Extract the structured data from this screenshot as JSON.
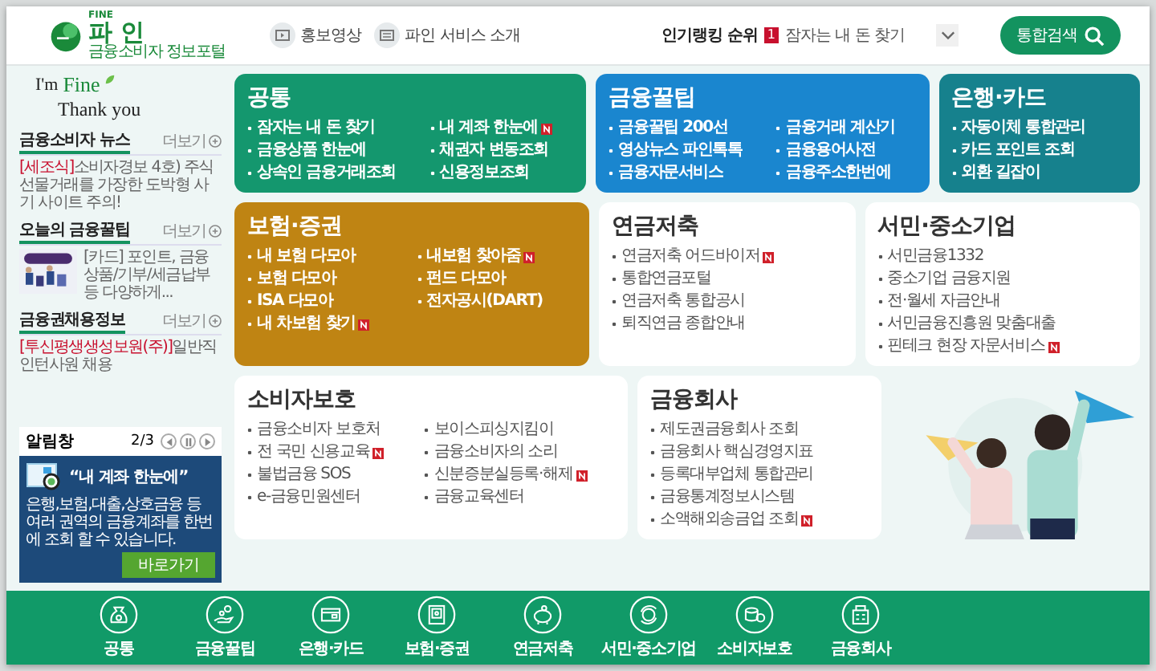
{
  "header": {
    "logo": {
      "mark": "FINE",
      "name": "파 인",
      "subtitle": "금융소비자 정보포털"
    },
    "nav": [
      {
        "label": "홍보영상"
      },
      {
        "label": "파인 서비스 소개"
      }
    ],
    "ranking": {
      "label": "인기랭킹 순위",
      "rank": "1",
      "item": "잠자는 내 돈 찾기"
    },
    "search_button": "통합검색"
  },
  "greeting": {
    "prefix": "I'm",
    "word": "Fine",
    "line2": "Thank you"
  },
  "sidebar": [
    {
      "title": "금융소비자 뉴스",
      "more": "더보기",
      "tag": "[세조식]",
      "text": "소비자경보 4호) 주식선물거래를 가장한 도박형 사기 사이트 주의!"
    },
    {
      "title": "오늘의 금융꿀팁",
      "more": "더보기",
      "image": {
        "kind": "picture"
      },
      "text": "[카드] 포인트, 금융상품/기부/세금납부 등 다양하게..."
    },
    {
      "title": "금융권채용정보",
      "more": "더보기",
      "tag": "[투신평생생성보원(주)]",
      "text": "일반직 인턴사원 채용"
    }
  ],
  "notice": {
    "title": "알림창",
    "page": "2/3",
    "banner_title": "“내 계좌 한눈에”",
    "banner_text": "은행,보험,대출,상호금융 등 여러 권역의 금융계좌를 한번에 조회 할 수 있습니다.",
    "banner_button": "바로가기"
  },
  "card_rows": [
    [
      {
        "title": "공통",
        "color": "#14976e",
        "items": [
          {
            "label": "잠자는 내 돈 찾기",
            "new": false
          },
          {
            "label": "내 계좌 한눈에",
            "new": true
          },
          {
            "label": "금융상품 한눈에",
            "new": false
          },
          {
            "label": "채권자 변동조회",
            "new": false
          },
          {
            "label": "상속인 금융거래조회",
            "new": false
          },
          {
            "label": "신용정보조회",
            "new": false
          }
        ]
      },
      {
        "title": "금융꿀팁",
        "color": "#1a86cf",
        "items": [
          {
            "label": "금융꿀팁 200선",
            "new": false
          },
          {
            "label": "금융거래 계산기",
            "new": false
          },
          {
            "label": "영상뉴스 파인톡톡",
            "new": false
          },
          {
            "label": "금융용어사전",
            "new": false
          },
          {
            "label": "금융자문서비스",
            "new": false
          },
          {
            "label": "금융주소한번에",
            "new": false
          }
        ]
      },
      {
        "title": "은행·카드",
        "color": "#16818d",
        "items": [
          {
            "label": "자동이체 통합관리",
            "new": false
          },
          {
            "label": "카드 포인트 조회",
            "new": false
          },
          {
            "label": "외환 길잡이",
            "new": false
          }
        ]
      }
    ],
    [
      {
        "title": "보험·증권",
        "color": "#bf8413",
        "items": [
          {
            "label": "내 보험 다모아",
            "new": false
          },
          {
            "label": "내보험 찾아줌",
            "new": true
          },
          {
            "label": "보험 다모아",
            "new": false
          },
          {
            "label": "펀드 다모아",
            "new": false
          },
          {
            "label": "ISA 다모아",
            "new": false
          },
          {
            "label": "전자공시(DART)",
            "new": false
          },
          {
            "label": "내 차보험 찾기",
            "new": true
          }
        ]
      },
      {
        "title": "연금저축",
        "items": [
          {
            "label": "연금저축 어드바이저",
            "new": true
          },
          {
            "label": "통합연금포털",
            "new": false
          },
          {
            "label": "연금저축 통합공시",
            "new": false
          },
          {
            "label": "퇴직연금 종합안내",
            "new": false
          }
        ]
      },
      {
        "title": "서민·중소기업",
        "items": [
          {
            "label": "서민금융1332",
            "new": false
          },
          {
            "label": "중소기업 금융지원",
            "new": false
          },
          {
            "label": "전·월세 자금안내",
            "new": false
          },
          {
            "label": "서민금융진흥원 맞춤대출",
            "new": false
          },
          {
            "label": "핀테크 현장 자문서비스",
            "new": true
          }
        ]
      }
    ],
    [
      {
        "title": "소비자보호",
        "items": [
          {
            "label": "금융소비자 보호처",
            "new": false
          },
          {
            "label": "보이스피싱지킴이",
            "new": false
          },
          {
            "label": "전 국민 신용교육",
            "new": true
          },
          {
            "label": "금융소비자의 소리",
            "new": false
          },
          {
            "label": "불법금융 SOS",
            "new": false
          },
          {
            "label": "신분증분실등록·해제",
            "new": true
          },
          {
            "label": "e-금융민원센터",
            "new": false
          },
          {
            "label": "금융교육센터",
            "new": false
          }
        ]
      },
      {
        "title": "금융회사",
        "items": [
          {
            "label": "제도권금융회사 조회",
            "new": false
          },
          {
            "label": "금융회사 핵심경영지표",
            "new": false
          },
          {
            "label": "등록대부업체 통합관리",
            "new": false
          },
          {
            "label": "금융통계정보시스템",
            "new": false
          },
          {
            "label": "소액해외송금업 조회",
            "new": true
          }
        ]
      }
    ]
  ],
  "hero": {
    "kind": "picture"
  },
  "bottom_nav": [
    {
      "label": "공통"
    },
    {
      "label": "금융꿀팁"
    },
    {
      "label": "은행·카드"
    },
    {
      "label": "보험·증권"
    },
    {
      "label": "연금저축"
    },
    {
      "label": "서민·중소기업"
    },
    {
      "label": "소비자보호"
    },
    {
      "label": "금융회사"
    }
  ]
}
